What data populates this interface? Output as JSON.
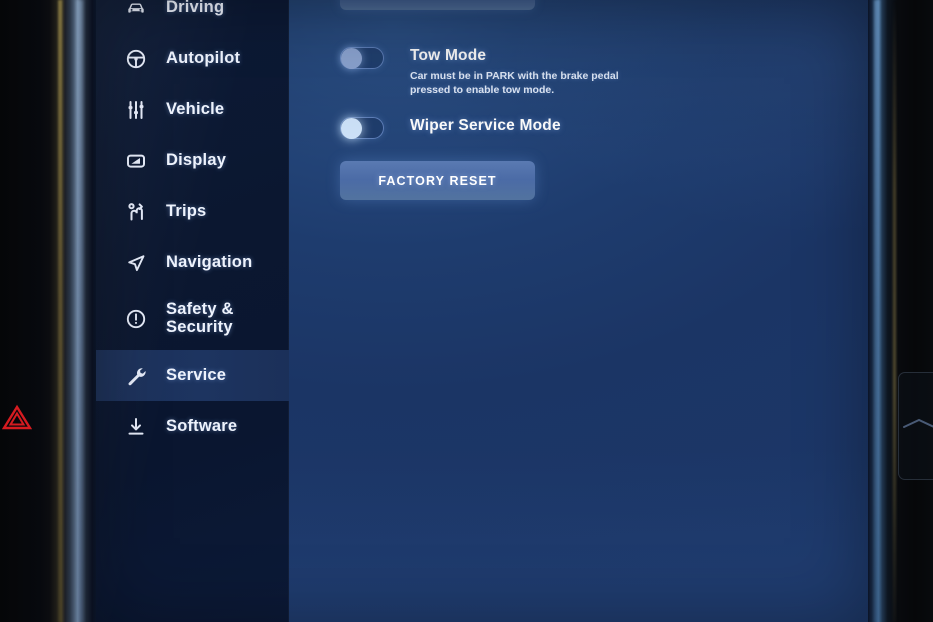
{
  "screen": {
    "background_color": "#1c3768",
    "sidebar_color": "#0b1730",
    "accent_color": "#4b6ba6",
    "highlight_color": "#1d3460"
  },
  "sidebar": {
    "items": [
      {
        "label": "Driving",
        "icon": "car-icon",
        "active": false
      },
      {
        "label": "Autopilot",
        "icon": "steering-wheel-icon",
        "active": false
      },
      {
        "label": "Vehicle",
        "icon": "sliders-icon",
        "active": false
      },
      {
        "label": "Display",
        "icon": "brightness-icon",
        "active": false
      },
      {
        "label": "Trips",
        "icon": "winding-road-icon",
        "active": false
      },
      {
        "label": "Navigation",
        "icon": "navigation-arrow-icon",
        "active": false
      },
      {
        "label": "Safety & Security",
        "icon": "alert-circle-icon",
        "active": false
      },
      {
        "label": "Service",
        "icon": "wrench-icon",
        "active": true
      },
      {
        "label": "Software",
        "icon": "download-icon",
        "active": false
      }
    ]
  },
  "main": {
    "settings": [
      {
        "title": "Tow Mode",
        "description": "Car must be in PARK with the brake pedal pressed to enable tow mode.",
        "toggle_state": "off"
      },
      {
        "title": "Wiper Service Mode",
        "description": "",
        "toggle_state": "off"
      }
    ],
    "factory_reset_label": "FACTORY RESET"
  },
  "controls": {
    "hazard_icon": "hazard-triangle-icon",
    "hazard_color": "#d61b20"
  }
}
